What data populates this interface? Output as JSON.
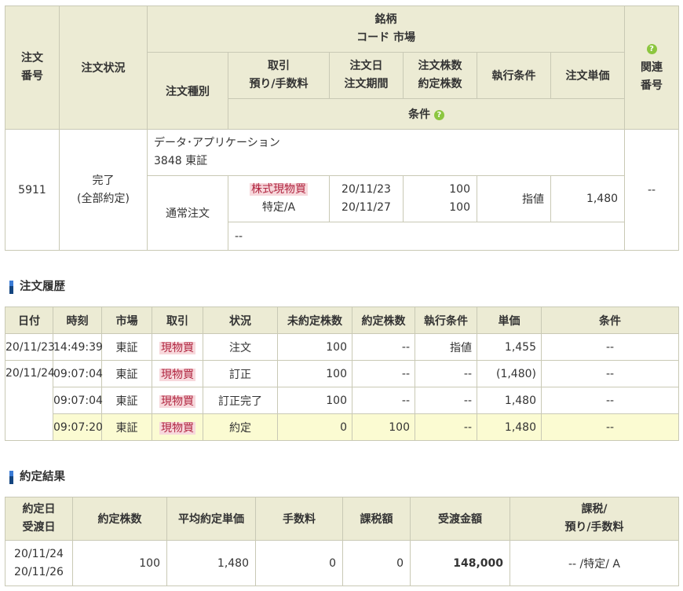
{
  "order": {
    "headers": {
      "order_no": [
        "注文",
        "番号"
      ],
      "status": "注文状況",
      "brand_lines": [
        "銘柄",
        "コード 市場"
      ],
      "order_type": "注文種別",
      "trade": [
        "取引",
        "預り/手数料"
      ],
      "order_date": [
        "注文日",
        "注文期間"
      ],
      "qty": [
        "注文株数",
        "約定株数"
      ],
      "exec_cond": "執行条件",
      "price": "注文単価",
      "condition": "条件",
      "related_no": [
        "関連",
        "番号"
      ]
    },
    "row": {
      "order_no": "5911",
      "status_lines": [
        "完了",
        "(全部約定)"
      ],
      "brand_name": "データ･アプリケーション",
      "code_market": "3848  東証",
      "order_type": "通常注文",
      "trade": "株式現物買",
      "account": "特定/A",
      "order_date": "20/11/23",
      "order_period": "20/11/27",
      "order_qty": "100",
      "exec_qty": "100",
      "exec_cond": "指値",
      "price": "1,480",
      "related_no": "--",
      "condition": "--"
    }
  },
  "history": {
    "title": "注文履歴",
    "headers": [
      "日付",
      "時刻",
      "市場",
      "取引",
      "状況",
      "未約定株数",
      "約定株数",
      "執行条件",
      "単価",
      "条件"
    ],
    "rows": [
      {
        "date": "20/11/23",
        "time": "14:49:39",
        "market": "東証",
        "trade": "現物買",
        "status": "注文",
        "unexec": "100",
        "exec": "--",
        "cond": "指値",
        "price": "1,455",
        "condition": "--"
      },
      {
        "date": "20/11/24",
        "time": "09:07:04",
        "market": "東証",
        "trade": "現物買",
        "status": "訂正",
        "unexec": "100",
        "exec": "--",
        "cond": "--",
        "price": "(1,480)",
        "condition": "--"
      },
      {
        "date": "",
        "time": "09:07:04",
        "market": "東証",
        "trade": "現物買",
        "status": "訂正完了",
        "unexec": "100",
        "exec": "--",
        "cond": "--",
        "price": "1,480",
        "condition": "--"
      },
      {
        "date": "",
        "time": "09:07:20",
        "market": "東証",
        "trade": "現物買",
        "status": "約定",
        "unexec": "0",
        "exec": "100",
        "cond": "--",
        "price": "1,480",
        "condition": "--"
      }
    ]
  },
  "result": {
    "title": "約定結果",
    "headers": {
      "dates": [
        "約定日",
        "受渡日"
      ],
      "qty": "約定株数",
      "avg_price": "平均約定単価",
      "fee": "手数料",
      "tax": "課税額",
      "amount": "受渡金額",
      "account": [
        "課税/",
        "預り/手数料"
      ]
    },
    "row": {
      "exec_date": "20/11/24",
      "settle_date": "20/11/26",
      "qty": "100",
      "avg_price": "1,480",
      "fee": "0",
      "tax": "0",
      "amount": "148,000",
      "account": "-- /特定/ A"
    }
  },
  "icons": {
    "help": "?"
  },
  "colors": {
    "header_bg": "#ecebd4",
    "highlight_row": "#fbfbd2",
    "trade_badge_bg": "#f7d8dc",
    "help_icon": "#8cc63f"
  }
}
